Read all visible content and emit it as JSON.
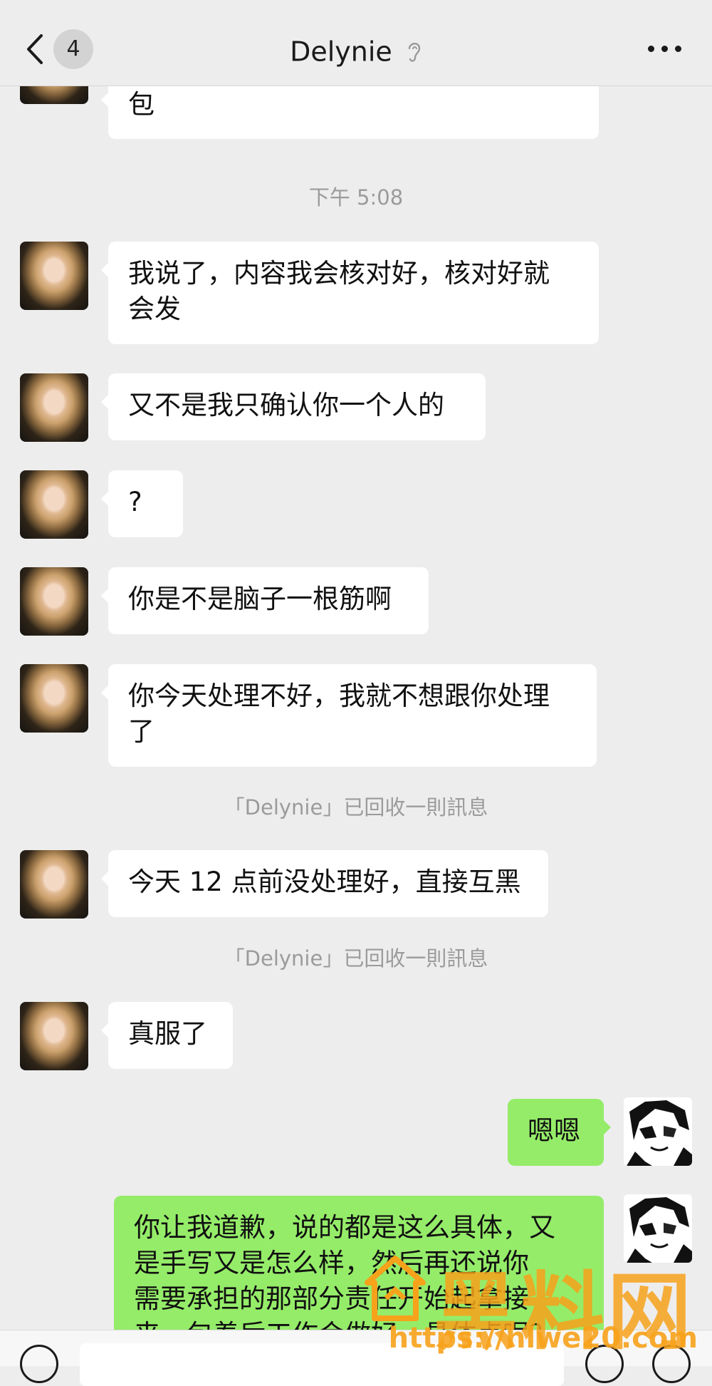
{
  "header": {
    "unread_count": "4",
    "title": "Delynie"
  },
  "messages": [
    {
      "text": "包"
    },
    {
      "text": "我说了，内容我会核对好，核对好就\n会发"
    },
    {
      "text": "又不是我只确认你一个人的"
    },
    {
      "text": "?"
    },
    {
      "text": "你是不是脑子一根筋啊"
    },
    {
      "text": "你今天处理不好，我就不想跟你处理\n了"
    },
    {
      "text": "今天 12 点前没处理好，直接互黑"
    },
    {
      "text": "真服了"
    },
    {
      "text": "嗯嗯"
    },
    {
      "text": "你让我道歉，说的都是这么具体，又\n是手写又是怎么样，然后再还说你\n需要承担的那部分责任开始起拿接\n来，包着后工作会做好，具体点呢？"
    }
  ],
  "system": {
    "timestamp": "下午 5:08",
    "recall_1": "「Delynie」已回收一則訊息",
    "recall_2": "「Delynie」已回收一則訊息"
  },
  "watermark": {
    "logo_text": "黑料网",
    "url": "https://hlwe20.com"
  },
  "colors": {
    "background": "#ededed",
    "bubble_left": "#ffffff",
    "bubble_right": "#95ec69",
    "watermark": "#f7a21b"
  },
  "icons": [
    "back-chevron-icon",
    "ear-icon",
    "more-dots-icon",
    "voice-icon",
    "emoji-icon",
    "plus-icon"
  ]
}
